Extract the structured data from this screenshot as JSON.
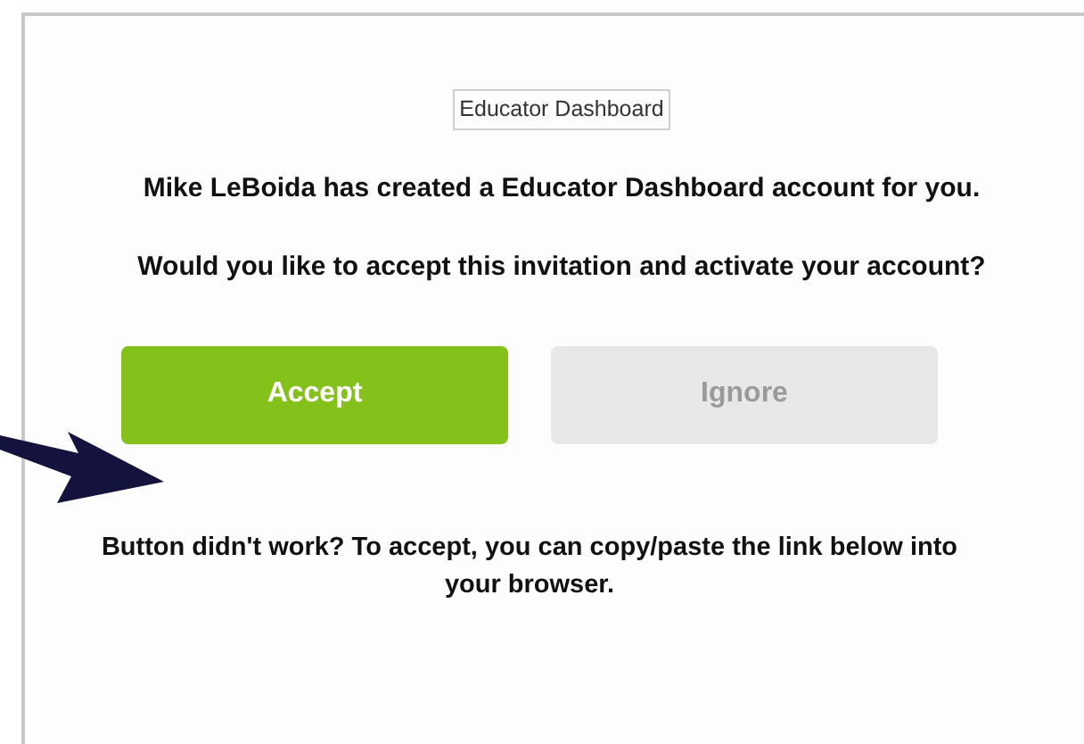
{
  "logo": {
    "text": "Educator Dashboard"
  },
  "message": "Mike LeBoida has created a Educator Dashboard account for you.",
  "question": "Would you like to accept this invitation and activate your account?",
  "buttons": [
    {
      "label": "Accept",
      "kind": "primary"
    },
    {
      "label": "Ignore",
      "kind": "secondary"
    }
  ],
  "footer": "Button didn't work? To accept, you can copy/paste the link below into your browser."
}
